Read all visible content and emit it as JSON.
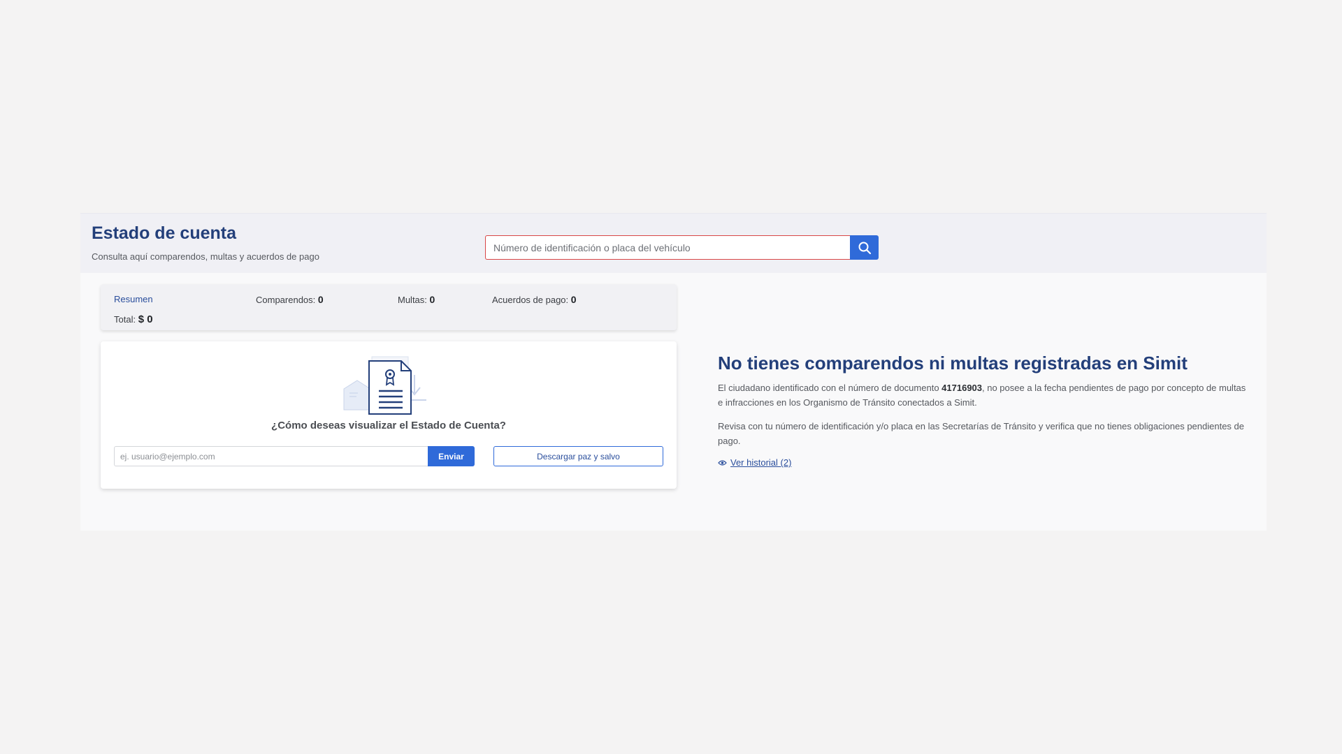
{
  "header": {
    "title": "Estado de cuenta",
    "subtitle": "Consulta aquí comparendos, multas y acuerdos de pago"
  },
  "search": {
    "placeholder": "Número de identificación o placa del vehículo",
    "button_icon": "search-icon",
    "accent_color": "#2f6ad9",
    "border_color": "#d84646"
  },
  "summary": {
    "tab_label": "Resumen",
    "comparendos_label": "Comparendos:",
    "comparendos_value": "0",
    "multas_label": "Multas:",
    "multas_value": "0",
    "acuerdos_label": "Acuerdos de pago:",
    "acuerdos_value": "0",
    "total_label": "Total:",
    "total_value": "$ 0"
  },
  "download": {
    "illustration_icon": "certificate-document-icon",
    "question": "¿Cómo deseas visualizar el Estado de Cuenta?",
    "email_placeholder": "ej. usuario@ejemplo.com",
    "send_label": "Enviar",
    "download_label": "Descargar paz y salvo"
  },
  "info": {
    "title": "No tienes comparendos ni multas registradas en Simit",
    "text1_before": "El ciudadano identificado con el número de documento ",
    "document_number": "41716903",
    "text1_after": ", no posee a la fecha pendientes de pago por concepto de multas e infracciones en los Organismo de Tránsito conectados a Simit.",
    "text2": "Revisa con tu número de identificación y/o placa en las Secretarías de Tránsito y verifica que no tienes obligaciones pendientes de pago.",
    "history_link": "Ver historial (2)",
    "history_icon": "eye-icon"
  }
}
